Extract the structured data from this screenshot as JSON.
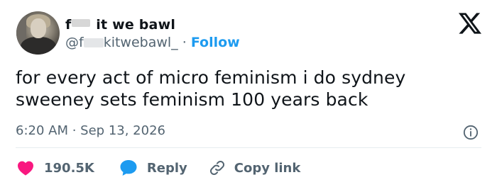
{
  "author": {
    "name_prefix": "f",
    "name_suffix": "it we bawl",
    "handle_prefix": "@f",
    "handle_suffix": "kitwebawl_",
    "separator": " · ",
    "follow_label": "Follow"
  },
  "platform_icon": "x-logo-icon",
  "tweet": {
    "line1": "for every act of micro feminism i do sydney",
    "line2": "sweeney sets feminism 100 years back"
  },
  "meta": {
    "time": "6:20 AM",
    "separator": " · ",
    "date": "Sep 13, 2026"
  },
  "actions": {
    "like_count": "190.5K",
    "reply_label": "Reply",
    "copy_label": "Copy link"
  },
  "colors": {
    "like": "#f91880",
    "reply": "#1d9bf0",
    "follow": "#1d9bf0",
    "muted": "#536471",
    "text": "#0f1419"
  }
}
